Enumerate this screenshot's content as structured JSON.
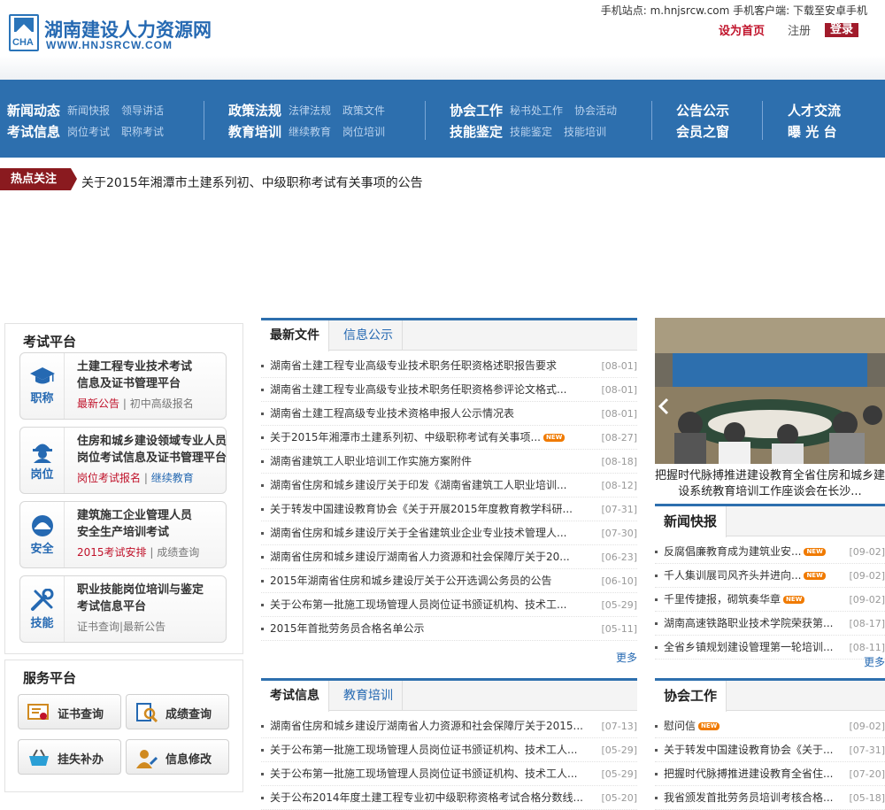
{
  "header": {
    "logo_cn": "湖南建设人力资源网",
    "logo_en": "WWW.HNJSRCW.COM",
    "logo_box": "CHA",
    "top_info": "手机站点: m.hnjsrcw.com 手机客户端: 下载至安卓手机",
    "set_home": "设为首页",
    "register": "注册",
    "login": "登录"
  },
  "nav": [
    {
      "rows": [
        {
          "main": "新闻动态",
          "subs": [
            "新闻快报",
            "领导讲话"
          ]
        },
        {
          "main": "考试信息",
          "subs": [
            "岗位考试",
            "职称考试"
          ]
        }
      ]
    },
    {
      "rows": [
        {
          "main": "政策法规",
          "subs": [
            "法律法规",
            "政策文件"
          ]
        },
        {
          "main": "教育培训",
          "subs": [
            "继续教育",
            "岗位培训"
          ]
        }
      ]
    },
    {
      "rows": [
        {
          "main": "协会工作",
          "subs": [
            "秘书处工作",
            "协会活动"
          ]
        },
        {
          "main": "技能鉴定",
          "subs": [
            "技能鉴定",
            "技能培训"
          ]
        }
      ]
    },
    {
      "rows": [
        {
          "main": "公告公示",
          "subs": []
        },
        {
          "main": "会员之窗",
          "subs": []
        }
      ]
    },
    {
      "rows": [
        {
          "main": "人才交流",
          "subs": []
        },
        {
          "main": "曝 光 台",
          "subs": []
        }
      ]
    }
  ],
  "hot": {
    "tag": "热点关注",
    "text": "关于2015年湘潭市土建系列初、中级职称考试有关事项的公告"
  },
  "exam_platform": {
    "title": "考试平台",
    "cards": [
      {
        "icon_label": "职称",
        "title1": "土建工程专业技术考试",
        "title2": "信息及证书管理平台",
        "link1": "最新公告",
        "link2": "初中高级报名"
      },
      {
        "icon_label": "岗位",
        "title1": "住房和城乡建设领域专业人员",
        "title2": "岗位考试信息及证书管理平台",
        "link1": "岗位考试报名",
        "link2": "继续教育"
      },
      {
        "icon_label": "安全",
        "title1": "建筑施工企业管理人员",
        "title2": "安全生产培训考试",
        "link1": "2015考试安排",
        "link2": "成绩查询"
      },
      {
        "icon_label": "技能",
        "title1": "职业技能岗位培训与鉴定",
        "title2": "考试信息平台",
        "link1": "证书查询",
        "link2": "最新公告"
      }
    ]
  },
  "service_platform": {
    "title": "服务平台",
    "buttons": [
      "证书查询",
      "成绩查询",
      "挂失补办",
      "信息修改"
    ]
  },
  "files": {
    "tab1": "最新文件",
    "tab2": "信息公示",
    "items": [
      {
        "text": "湖南省土建工程专业高级专业技术职务任职资格述职报告要求",
        "date": "[08-01]",
        "new": false
      },
      {
        "text": "湖南省土建工程专业高级专业技术职务任职资格参评论文格式...",
        "date": "[08-01]",
        "new": false
      },
      {
        "text": "湖南省土建工程高级专业技术资格申报人公示情况表",
        "date": "[08-01]",
        "new": false
      },
      {
        "text": "关于2015年湘潭市土建系列初、中级职称考试有关事项...",
        "date": "[08-27]",
        "new": true
      },
      {
        "text": "湖南省建筑工人职业培训工作实施方案附件",
        "date": "[08-18]",
        "new": false
      },
      {
        "text": "湖南省住房和城乡建设厅关于印发《湖南省建筑工人职业培训...",
        "date": "[08-12]",
        "new": false
      },
      {
        "text": "关于转发中国建设教育协会《关于开展2015年度教育教学科研...",
        "date": "[07-31]",
        "new": false
      },
      {
        "text": "湖南省住房和城乡建设厅关于全省建筑业企业专业技术管理人...",
        "date": "[07-30]",
        "new": false
      },
      {
        "text": "湖南省住房和城乡建设厅湖南省人力资源和社会保障厅关于20...",
        "date": "[06-23]",
        "new": false
      },
      {
        "text": "2015年湖南省住房和城乡建设厅关于公开选调公务员的公告",
        "date": "[06-10]",
        "new": false
      },
      {
        "text": "关于公布第一批施工现场管理人员岗位证书颁证机构、技术工...",
        "date": "[05-29]",
        "new": false
      },
      {
        "text": "2015年首批劳务员合格名单公示",
        "date": "[05-11]",
        "new": false
      }
    ],
    "more": "更多"
  },
  "exams": {
    "tab1": "考试信息",
    "tab2": "教育培训",
    "items": [
      {
        "text": "湖南省住房和城乡建设厅湖南省人力资源和社会保障厅关于2015...",
        "date": "[07-13]"
      },
      {
        "text": "关于公布第一批施工现场管理人员岗位证书颁证机构、技术工人...",
        "date": "[05-29]"
      },
      {
        "text": "关于公布第一批施工现场管理人员岗位证书颁证机构、技术工人...",
        "date": "[05-29]"
      },
      {
        "text": "关于公布2014年度土建工程专业初中级职称资格考试合格分数线...",
        "date": "[05-20]"
      }
    ]
  },
  "photo": {
    "caption": "把握时代脉搏推进建设教育全省住房和城乡建设系统教育培训工作座谈会在长沙..."
  },
  "news": {
    "title": "新闻快报",
    "items": [
      {
        "text": "反腐倡廉教育成为建筑业安...",
        "date": "[09-02]",
        "new": true
      },
      {
        "text": "千人集训展司风齐头并进向...",
        "date": "[09-02]",
        "new": true
      },
      {
        "text": "千里传捷报，砌筑奏华章",
        "date": "[09-02]",
        "new": true
      },
      {
        "text": "湖南高速铁路职业技术学院荣获第...",
        "date": "[08-17]",
        "new": false
      },
      {
        "text": "全省乡镇规划建设管理第一轮培训...",
        "date": "[08-11]",
        "new": false
      }
    ],
    "more": "更多"
  },
  "assoc": {
    "title": "协会工作",
    "items": [
      {
        "text": "慰问信",
        "date": "[09-02]",
        "new": true
      },
      {
        "text": "关于转发中国建设教育协会《关于...",
        "date": "[07-31]",
        "new": false
      },
      {
        "text": "把握时代脉搏推进建设教育全省住...",
        "date": "[07-20]",
        "new": false
      },
      {
        "text": "我省颁发首批劳务员培训考核合格...",
        "date": "[05-18]",
        "new": false
      }
    ]
  },
  "colors": {
    "brand_blue": "#2d6fae",
    "accent_red": "#c0122a",
    "hot_red": "#8a1a1f"
  }
}
